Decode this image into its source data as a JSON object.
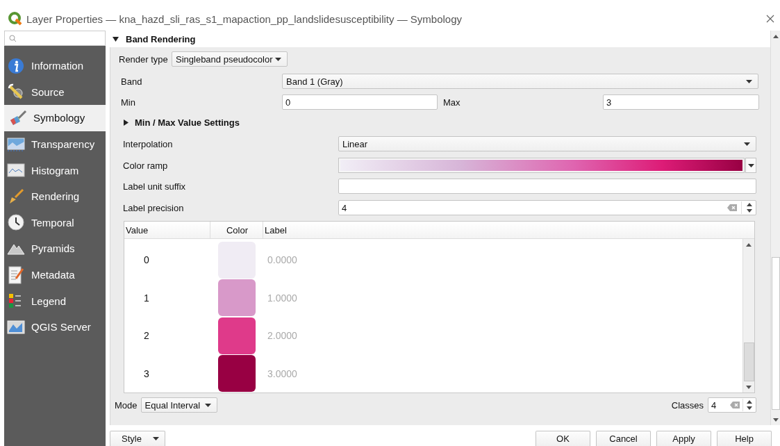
{
  "window": {
    "title": "Layer Properties — kna_hazd_sli_ras_s1_mapaction_pp_landslidesusceptibility — Symbology"
  },
  "sidebar": {
    "items": [
      {
        "label": "Information",
        "selected": false
      },
      {
        "label": "Source",
        "selected": false
      },
      {
        "label": "Symbology",
        "selected": true
      },
      {
        "label": "Transparency",
        "selected": false
      },
      {
        "label": "Histogram",
        "selected": false
      },
      {
        "label": "Rendering",
        "selected": false
      },
      {
        "label": "Temporal",
        "selected": false
      },
      {
        "label": "Pyramids",
        "selected": false
      },
      {
        "label": "Metadata",
        "selected": false
      },
      {
        "label": "Legend",
        "selected": false
      },
      {
        "label": "QGIS Server",
        "selected": false
      }
    ]
  },
  "band_rendering": {
    "title": "Band Rendering",
    "expanded": true,
    "render_type_label": "Render type",
    "render_type": "Singleband pseudocolor",
    "band_label": "Band",
    "band": "Band 1 (Gray)",
    "min_label": "Min",
    "min": "0",
    "max_label": "Max",
    "max": "3",
    "minmax_settings": {
      "title": "Min / Max Value Settings",
      "expanded": false
    },
    "interpolation_label": "Interpolation",
    "interpolation": "Linear",
    "color_ramp_label": "Color ramp",
    "label_unit_suffix_label": "Label unit suffix",
    "label_precision_label": "Label precision",
    "label_precision": "4",
    "table": {
      "columns": [
        "Value",
        "Color",
        "Label"
      ],
      "rows": [
        {
          "value": "0",
          "color": "#f0ecf4",
          "label": "0.0000"
        },
        {
          "value": "1",
          "color": "#d899c9",
          "label": "1.0000"
        },
        {
          "value": "2",
          "color": "#df3a8a",
          "label": "2.0000"
        },
        {
          "value": "3",
          "color": "#980043",
          "label": "3.0000"
        }
      ]
    },
    "mode_label": "Mode",
    "mode": "Equal Interval",
    "classes_label": "Classes",
    "classes": "4"
  },
  "footer": {
    "style": "Style",
    "buttons": [
      "OK",
      "Cancel",
      "Apply",
      "Help"
    ]
  }
}
